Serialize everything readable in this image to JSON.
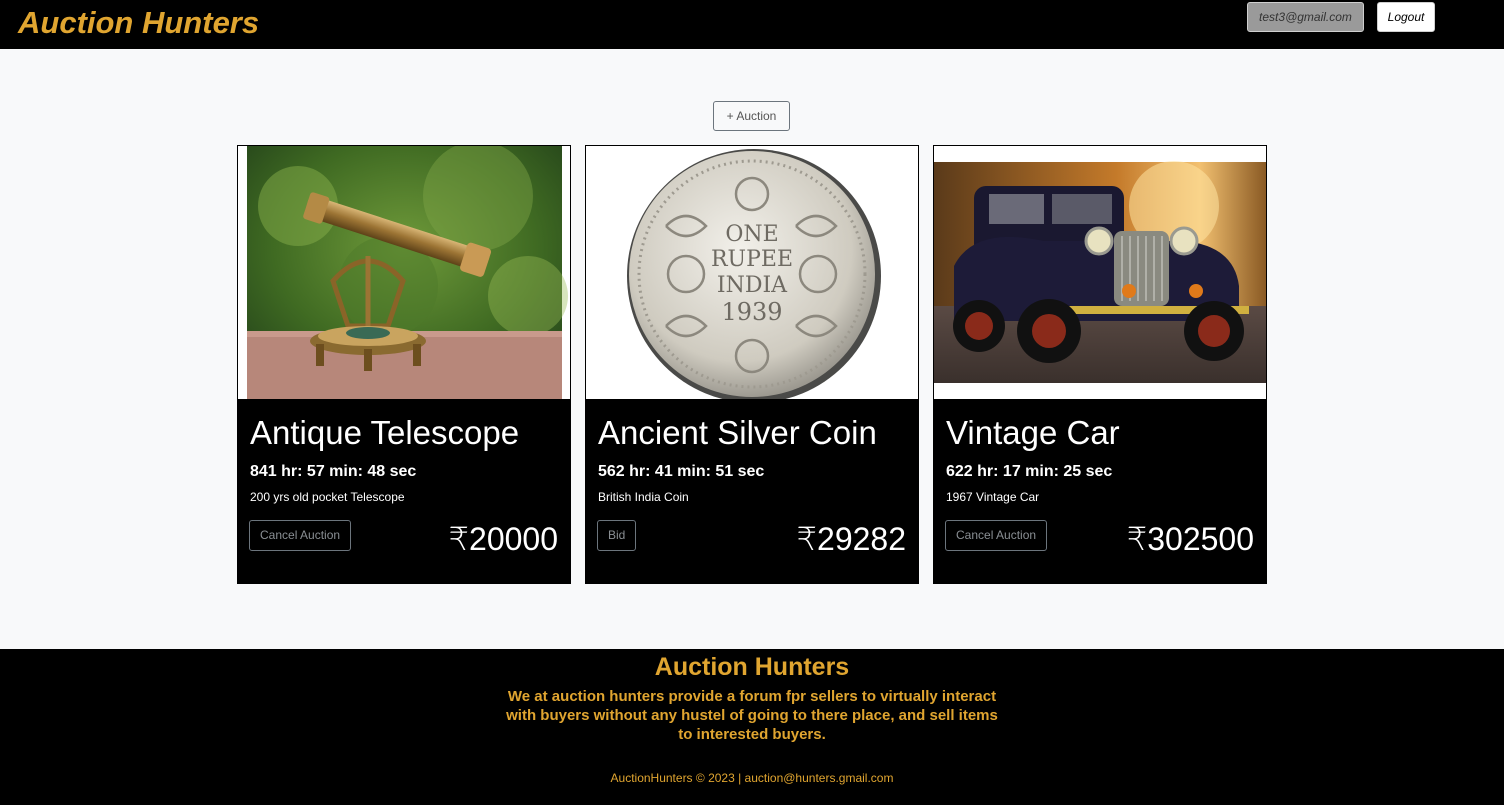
{
  "header": {
    "brand": "Auction Hunters",
    "user_email": "test3@gmail.com",
    "logout_label": "Logout"
  },
  "main": {
    "add_auction_label": "+ Auction",
    "cards": [
      {
        "title": "Antique Telescope",
        "timer": "841 hr: 57 min: 48 sec",
        "description": "200 yrs old pocket Telescope",
        "action_label": "Cancel Auction",
        "price": "₹20000",
        "image": "telescope-photo"
      },
      {
        "title": "Ancient Silver Coin",
        "timer": "562 hr: 41 min: 51 sec",
        "description": "British India Coin",
        "action_label": "Bid",
        "price": "₹29282",
        "image": "silver-coin-photo"
      },
      {
        "title": "Vintage Car",
        "timer": "622 hr: 17 min: 25 sec",
        "description": "1967 Vintage Car",
        "action_label": "Cancel Auction",
        "price": "₹302500",
        "image": "vintage-car-photo"
      }
    ]
  },
  "footer": {
    "title": "Auction Hunters",
    "tagline": "We at auction hunters provide a forum fpr sellers to virtually interact with buyers without any hustel of going to there place, and sell items to interested buyers.",
    "copyright": "AuctionHunters © 2023 | auction@hunters.gmail.com"
  },
  "colors": {
    "accent": "#e0a530",
    "header_bg": "#000000",
    "page_bg": "#f8f9fa"
  }
}
